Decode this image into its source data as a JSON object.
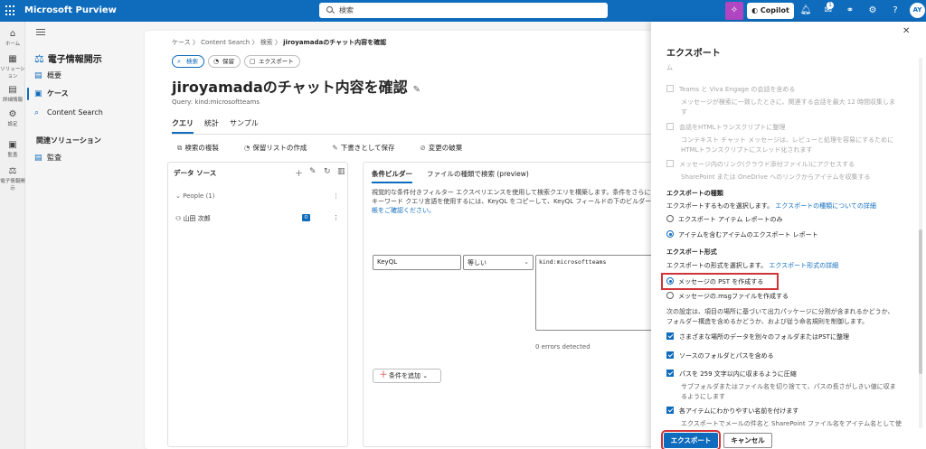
{
  "topbar": {
    "brand": "Microsoft Purview",
    "search_placeholder": "検索",
    "copilot": "Copilot",
    "notif_badge": "1",
    "avatar": "AY"
  },
  "rail": [
    {
      "icon": "⌂",
      "label": "ホーム"
    },
    {
      "icon": "▦",
      "label": "ソリューション"
    },
    {
      "icon": "▤",
      "label": "詳細情報"
    },
    {
      "icon": "⚙",
      "label": "設定"
    },
    {
      "icon": "▣",
      "label": "監査"
    },
    {
      "icon": "⚖",
      "label": "電子情報開示"
    }
  ],
  "nav": {
    "solution": "電子情報開示",
    "items": [
      {
        "icon": "▤",
        "label": "概要"
      },
      {
        "icon": "▣",
        "label": "ケース"
      },
      {
        "icon": "⌕",
        "label": "Content Search"
      }
    ],
    "section": "関連ソリューション",
    "related": [
      {
        "icon": "▤",
        "label": "監査"
      }
    ]
  },
  "page": {
    "breadcrumb": [
      "ケース",
      "Content Search",
      "検索"
    ],
    "breadcrumb_current": "jiroyamadaのチャット内容を確認",
    "pills": [
      "検索",
      "保留",
      "エクスポート"
    ],
    "title": "jiroyamadaのチャット内容を確認",
    "query": "Query: kind:microsoftteams",
    "tabs": [
      "クエリ",
      "統計",
      "サンプル"
    ],
    "actions": [
      "検索の複製",
      "保留リストの作成",
      "下書きとして保存",
      "変更の破棄"
    ]
  },
  "datasource": {
    "title": "データ ソース",
    "group": "People (1)",
    "user": "山田 次郎"
  },
  "builder": {
    "tabs": [
      "条件ビルダー",
      "ファイルの種類で検索 (preview)"
    ],
    "desc1": "視覚的な条件付きフィルター エクスペリエンスを使用して検索クエリを構築します。条件をさらに",
    "desc2": "キーワード クエリ言語を使用するには、KeyQL をコピーして、KeyQL フィールドの下のビルダー",
    "desc3": "帳をご確認ください。",
    "field": "KeyQL",
    "operator": "等しい",
    "value": "kind:microsoftteams",
    "errors": "0 errors detected",
    "add_condition": "条件を追加"
  },
  "export": {
    "title": "エクスポート",
    "cut_line": "ム",
    "teams_label": "Teams と Viva Engage の会話を含める",
    "teams_desc": "メッセージが検索に一致したときに、関連する会話を最大 12 時間収集しま",
    "teams_desc2": "す",
    "html_label": "会話をHTMLトランスクリプトに整理",
    "html_desc": "コンテキスト チャット メッセージは、レビューと処理を容易にするために",
    "html_desc2": "HTMLトランスクリプトにスレッド化されます",
    "links_label": "メッセージ内のリンク(クラウド添付ファイル)にアクセスする",
    "links_desc": "SharePoint または OneDrive へのリンクからアイテムを収集する",
    "type_heading": "エクスポートの種類",
    "type_desc": "エクスポートするものを選択します。",
    "type_link": "エクスポートの種類についての詳細",
    "type_opt1": "エクスポート アイテム レポートのみ",
    "type_opt2": "アイテムを含むアイテムのエクスポート レポート",
    "format_heading": "エクスポート形式",
    "format_desc": "エクスポートの形式を選択します。",
    "format_link": "エクスポート形式の詳細",
    "format_opt1": "メッセージの PST を作成する",
    "format_opt2": "メッセージの.msgファイルを作成する",
    "settings_desc1": "次の設定は、項目の場所に基づいて出力パッケージに分割が含まれるかどうか、",
    "settings_desc2": "フォルダー構造を含めるかどうか、および従う命名規則を制御します。",
    "opt_a": "さまざまな場所のデータを別々のフォルダまたはPSTに整理",
    "opt_b": "ソースのフォルダとパスを含める",
    "opt_c": "パスを 259 文字以内に収まるように圧縮",
    "opt_c_desc1": "サブフォルダまたはファイル名を切り捨てて、パスの長さがしきい値に収ま",
    "opt_c_desc2": "るようにします",
    "opt_d": "各アイテムにわかりやすい名前を付けます",
    "opt_d_desc": "エクスポートでメールの件名と SharePoint ファイル名をアイテム名として使",
    "btn_export": "エクスポート",
    "btn_cancel": "キャンセル"
  },
  "colors": {
    "accent": "#0f6cbd",
    "highlight": "#d13438",
    "copilot": "#b146c2"
  }
}
